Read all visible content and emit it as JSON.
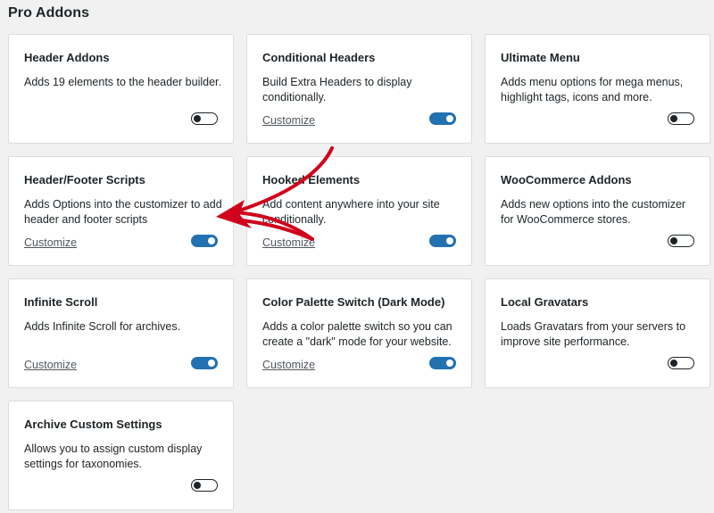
{
  "page": {
    "title": "Pro Addons"
  },
  "addons": [
    {
      "title": "Header Addons",
      "desc": "Adds 19 elements to the header builder.",
      "customize": "",
      "enabled": false
    },
    {
      "title": "Conditional Headers",
      "desc": "Build Extra Headers to display conditionally.",
      "customize": "Customize",
      "enabled": true
    },
    {
      "title": "Ultimate Menu",
      "desc": "Adds menu options for mega menus, highlight tags, icons and more.",
      "customize": "",
      "enabled": false
    },
    {
      "title": "Header/Footer Scripts",
      "desc": "Adds Options into the customizer to add header and footer scripts",
      "customize": "Customize",
      "enabled": true
    },
    {
      "title": "Hooked Elements",
      "desc": "Add content anywhere into your site conditionally.",
      "customize": "Customize",
      "enabled": true
    },
    {
      "title": "WooCommerce Addons",
      "desc": "Adds new options into the customizer for WooCommerce stores.",
      "customize": "",
      "enabled": false
    },
    {
      "title": "Infinite Scroll",
      "desc": "Adds Infinite Scroll for archives.",
      "customize": "Customize",
      "enabled": true
    },
    {
      "title": "Color Palette Switch (Dark Mode)",
      "desc": "Adds a color palette switch so you can create a \"dark\" mode for your website.",
      "customize": "Customize",
      "enabled": true
    },
    {
      "title": "Local Gravatars",
      "desc": "Loads Gravatars from your servers to improve site performance.",
      "customize": "",
      "enabled": false
    },
    {
      "title": "Archive Custom Settings",
      "desc": "Allows you to assign custom display settings for taxonomies.",
      "customize": "",
      "enabled": false
    }
  ],
  "colors": {
    "accent": "#2271b1",
    "annotation_arrow": "#d0021b"
  },
  "icons": {
    "annotation": "red-arrow-icon"
  }
}
